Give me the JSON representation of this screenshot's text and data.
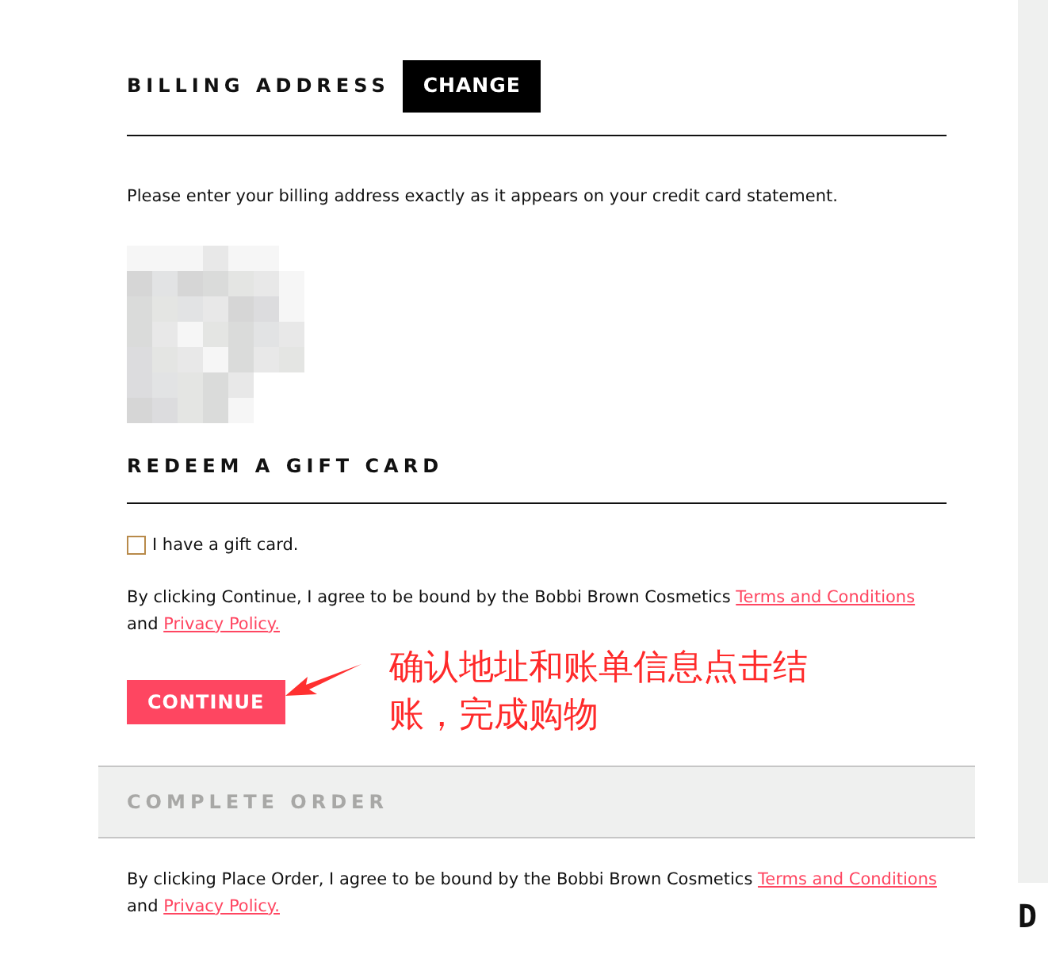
{
  "billing": {
    "title": "BILLING ADDRESS",
    "change_button": "CHANGE",
    "instructions": "Please enter your billing address exactly as it appears on your credit card statement."
  },
  "gift_card": {
    "title": "REDEEM A GIFT CARD",
    "checkbox": {
      "label": "I have a gift card.",
      "checked": false
    }
  },
  "continue_terms": {
    "text": "By clicking Continue, I agree to be bound by the Bobbi Brown Cosmetics ",
    "terms_link": "Terms and Conditions",
    "joiner": "and ",
    "privacy_link": "Privacy Policy."
  },
  "continue_button": "CONTINUE",
  "annotation": {
    "text": "确认地址和账单信息点击结账，完成购物"
  },
  "complete_order": {
    "title": "COMPLETE ORDER",
    "disabled": true
  },
  "place_order_terms": {
    "text": "By clicking Place Order, I agree to be bound by the Bobbi Brown Cosmetics ",
    "terms_link": "Terms and Conditions",
    "joiner": "and ",
    "privacy_link": "Privacy Policy."
  },
  "sidebar": {
    "heading": "D"
  }
}
